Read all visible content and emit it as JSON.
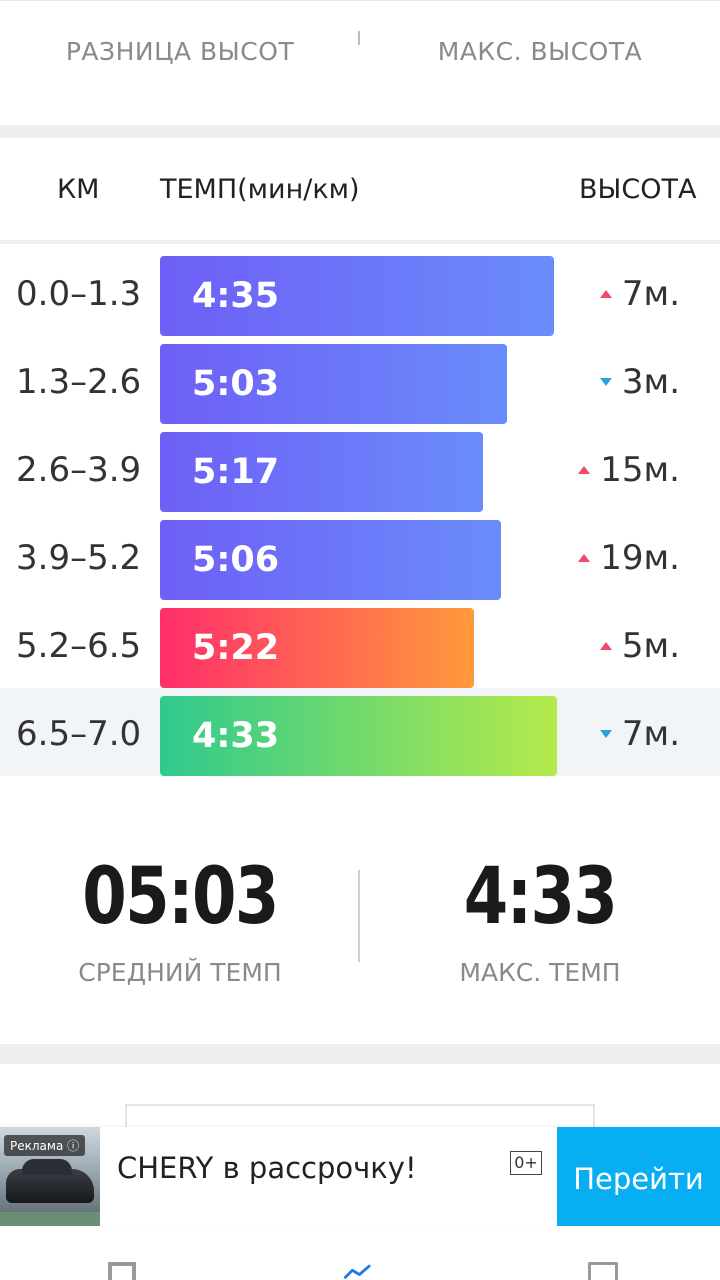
{
  "top_stats": {
    "left_label": "РАЗНИЦА ВЫСОТ",
    "right_label": "МАКС. ВЫСОТА"
  },
  "table": {
    "headers": {
      "km": "КМ",
      "pace": "ТЕМП(мин/км)",
      "elevation": "ВЫСОТА"
    },
    "rows": [
      {
        "km": "0.0–1.3",
        "pace": "4:35",
        "elevation": "7м.",
        "direction": "up",
        "style": "blue",
        "pace_min": 4.583
      },
      {
        "km": "1.3–2.6",
        "pace": "5:03",
        "elevation": "3м.",
        "direction": "down",
        "style": "blue",
        "pace_min": 5.05
      },
      {
        "km": "2.6–3.9",
        "pace": "5:17",
        "elevation": "15м.",
        "direction": "up",
        "style": "blue",
        "pace_min": 5.283
      },
      {
        "km": "3.9–5.2",
        "pace": "5:06",
        "elevation": "19м.",
        "direction": "up",
        "style": "blue",
        "pace_min": 5.1
      },
      {
        "km": "5.2–6.5",
        "pace": "5:22",
        "elevation": "5м.",
        "direction": "up",
        "style": "red",
        "pace_min": 5.367
      },
      {
        "km": "6.5–7.0",
        "pace": "4:33",
        "elevation": "7м.",
        "direction": "down",
        "style": "green",
        "pace_min": 4.55
      }
    ]
  },
  "summary": {
    "avg_pace": "05:03",
    "avg_pace_label": "СРЕДНИЙ ТЕМП",
    "max_pace": "4:33",
    "max_pace_label": "МАКС. ТЕМП"
  },
  "ad": {
    "tag": "Реклама ⓘ",
    "text": "CHERY в рассрочку!",
    "age": "0+",
    "button": "Перейти"
  },
  "colors": {
    "blue_bar": "#6e5ff6",
    "red_bar": "#ff2e6a",
    "green_bar": "#2fc98e",
    "up_arrow": "#f0476b",
    "down_arrow": "#2aa4d8",
    "ad_button": "#07aef1"
  },
  "nav": {
    "icons": [
      "map-icon",
      "chart-icon",
      "photo-icon"
    ]
  }
}
